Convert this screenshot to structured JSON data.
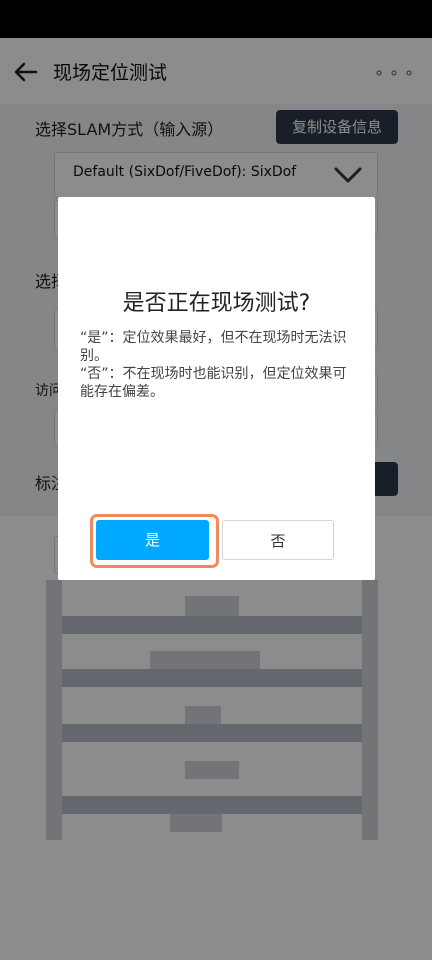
{
  "header": {
    "title": "现场定位测试",
    "more_icon": "more-icon",
    "back_icon": "back-arrow-icon"
  },
  "form": {
    "slam_label": "选择SLAM方式（输入源）",
    "copy_button": "复制设备信息",
    "slam_value": "Default (SixDof/FiveDof): SixDof",
    "select_label_partial": "选择",
    "visit_label_partial": "访问",
    "mark_label_partial": "标注"
  },
  "dialog": {
    "title": "是否正在现场测试?",
    "desc_line1": "“是”：定位效果最好，但不在现场时无法识别。",
    "desc_line2": "“否”：不在现场时也能识别，但定位效果可能存在偏差。",
    "yes_label": "是",
    "no_label": "否"
  },
  "colors": {
    "primary": "#00a8ff",
    "highlight_ring": "#f08a5d",
    "dark_button": "#2f3a4a"
  }
}
